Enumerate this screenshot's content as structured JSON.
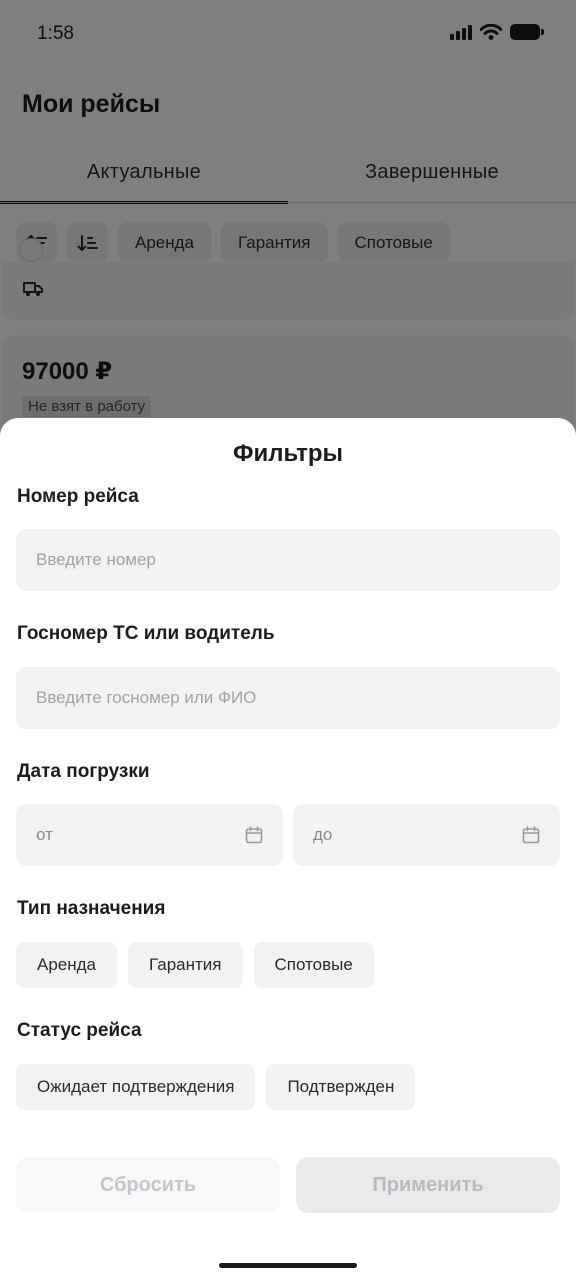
{
  "status_bar": {
    "time": "1:58",
    "icons": [
      "signal-icon",
      "wifi-icon",
      "battery-icon"
    ]
  },
  "page": {
    "title": "Мои рейсы",
    "tabs": [
      {
        "label": "Актуальные",
        "active": true
      },
      {
        "label": "Завершенные",
        "active": false
      }
    ],
    "filter_chips": [
      "Аренда",
      "Гарантия",
      "Спотовые"
    ],
    "sort_icons": [
      "sort-ascending-icon",
      "sort-descending-icon"
    ],
    "card": {
      "icon": "truck-icon",
      "price": "97000 ₽",
      "status_badge": "Не взят в работу"
    }
  },
  "sheet": {
    "title": "Фильтры",
    "trip_number": {
      "label": "Номер рейса",
      "placeholder": "Введите номер"
    },
    "vehicle": {
      "label": "Госномер ТС или водитель",
      "placeholder": "Введите госномер или ФИО"
    },
    "loading_date": {
      "label": "Дата погрузки",
      "from_placeholder": "от",
      "to_placeholder": "до",
      "icon": "calendar-icon"
    },
    "assignment_type": {
      "label": "Тип назначения",
      "options": [
        "Аренда",
        "Гарантия",
        "Спотовые"
      ]
    },
    "trip_status": {
      "label": "Статус рейса",
      "options": [
        "Ожидает подтверждения",
        "Подтвержден"
      ]
    },
    "reset_label": "Сбросить",
    "apply_label": "Применить"
  },
  "colors": {
    "overlay": "#000000",
    "sheet_bg": "#ffffff",
    "field_bg": "#f2f2f2",
    "text": "#1c1c1e",
    "placeholder": "#a2a2a2"
  }
}
